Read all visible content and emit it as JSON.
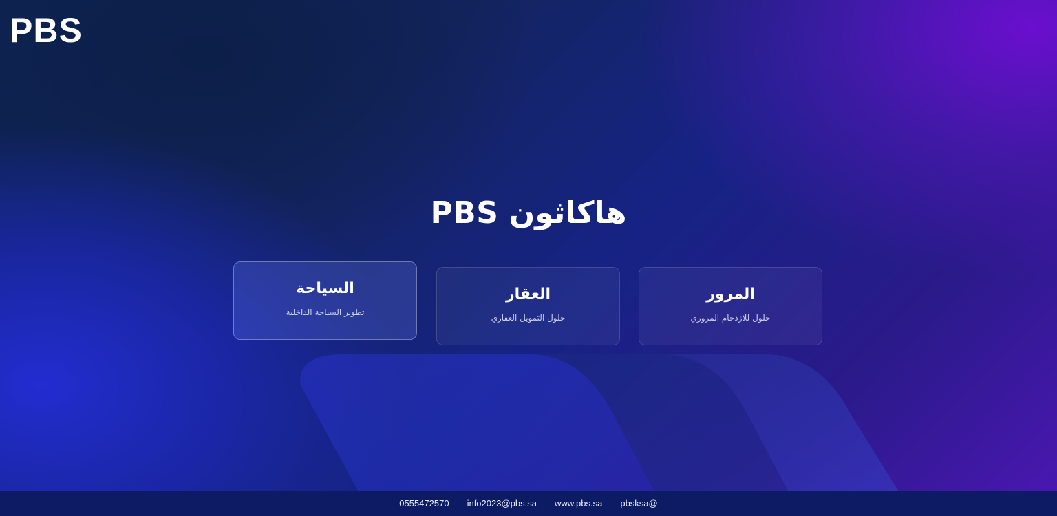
{
  "brand": {
    "logo_text": "PBS"
  },
  "hero": {
    "title": "هاكاثون PBS"
  },
  "cards": [
    {
      "title": "السياحة",
      "subtitle": "تطوير السياحة الداخلية",
      "active": true
    },
    {
      "title": "العقار",
      "subtitle": "حلول التمويل العقاري",
      "active": false
    },
    {
      "title": "المرور",
      "subtitle": "حلول للازدحام المروري",
      "active": false
    }
  ],
  "footer": {
    "phone": "0555472570",
    "email": "info2023@pbs.sa",
    "website": "www.pbs.sa",
    "social": "pbsksa@"
  },
  "colors": {
    "background_dark": "#0d2452",
    "background_blue": "#1e28d2",
    "background_purple": "#6a0ed2",
    "footer_bg": "#0c1b63",
    "text": "#ffffff"
  }
}
